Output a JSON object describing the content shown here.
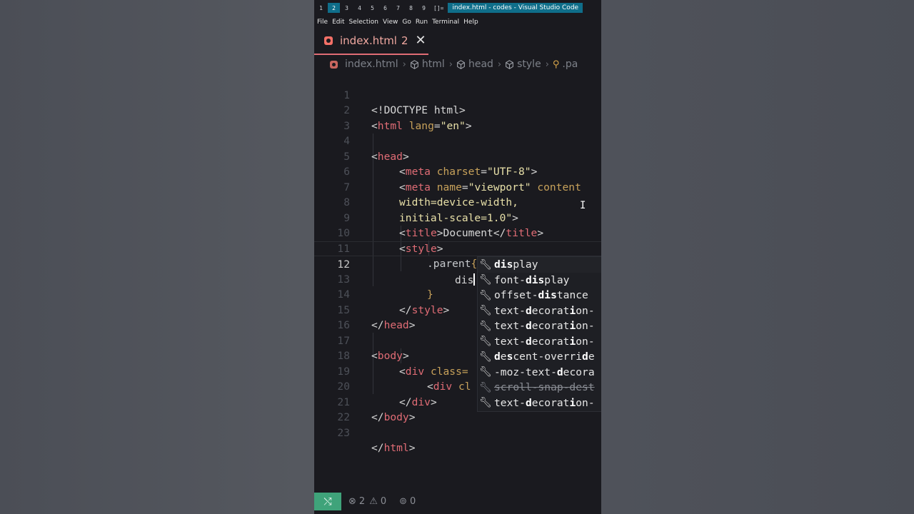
{
  "window": {
    "workspaces": [
      "1",
      "2",
      "3",
      "4",
      "5",
      "6",
      "7",
      "8",
      "9"
    ],
    "active_workspace": "2",
    "layout_indicator": "[]=",
    "title": "index.html - codes - Visual Studio Code"
  },
  "menu": [
    "File",
    "Edit",
    "Selection",
    "View",
    "Go",
    "Run",
    "Terminal",
    "Help"
  ],
  "tab": {
    "label": "index.html",
    "badge": "2",
    "close": "✕"
  },
  "breadcrumb": {
    "file": "index.html",
    "html": "html",
    "head": "head",
    "style": "style",
    "paren": ".pa"
  },
  "line_numbers": [
    "1",
    "2",
    "3",
    "4",
    "5",
    "6",
    "7",
    "8",
    "9",
    "10",
    "11",
    "12",
    "13",
    "14",
    "15",
    "16",
    "17",
    "18",
    "19",
    "20",
    "21",
    "22",
    "23"
  ],
  "code": {
    "l1": "<!DOCTYPE html>",
    "l2_lt": "<",
    "l2_tag": "html",
    "l2_attr": " lang",
    "l2_eq": "=",
    "l2_val": "\"en\"",
    "l2_gt": ">",
    "l4_lt": "<",
    "l4_tag": "head",
    "l4_gt": ">",
    "l5_lt": "<",
    "l5_tag": "meta",
    "l5_attr": " charset",
    "l5_eq": "=",
    "l5_val": "\"UTF-8\"",
    "l5_gt": ">",
    "l6_lt": "<",
    "l6_tag": "meta",
    "l6_attr": " name",
    "l6_eq": "=",
    "l6_val": "\"viewport\"",
    "l6_attr2": " content",
    "l7": "width=device-width,",
    "l8_text": "initial-scale=1.0\"",
    "l8_gt": ">",
    "l9_lt": "<",
    "l9_tag": "title",
    "l9_gt": ">",
    "l9_text": "Document",
    "l9_clt": "</",
    "l9_ctag": "title",
    "l9_cgt": ">",
    "l10_lt": "<",
    "l10_tag": "style",
    "l10_gt": ">",
    "l11_sel": ".parent",
    "l11_brace": "{",
    "l12": "dis",
    "l13": "}",
    "l14_lt": "</",
    "l14_tag": "style",
    "l14_gt": ">",
    "l15_lt": "</",
    "l15_tag": "head",
    "l15_gt": ">",
    "l17_lt": "<",
    "l17_tag": "body",
    "l17_gt": ">",
    "l18_lt": "<",
    "l18_tag": "div",
    "l18_attr": " class=",
    "l19_lt": "<",
    "l19_tag": "div",
    "l19_attr": " cl",
    "l20_lt": "</",
    "l20_tag": "div",
    "l20_gt": ">",
    "l21_lt": "</",
    "l21_tag": "body",
    "l21_gt": ">",
    "l23_lt": "</",
    "l23_tag": "html",
    "l23_gt": ">"
  },
  "suggestions": [
    {
      "match": "dis",
      "rest": "play"
    },
    {
      "pre": "font-",
      "match": "dis",
      "rest": "play"
    },
    {
      "pre": "offset-",
      "match": "dis",
      "rest": "tance"
    },
    {
      "pre": "text-",
      "match": "d",
      "mid": "ecorat",
      "match2": "i",
      "rest": "on-"
    },
    {
      "pre": "text-",
      "match": "d",
      "mid": "ecorat",
      "match2": "i",
      "rest": "on-"
    },
    {
      "pre": "text-",
      "match": "d",
      "mid": "ecorat",
      "match2": "i",
      "rest": "on-"
    },
    {
      "match": "d",
      "mid": "e",
      "match2": "s",
      "rest": "cent-overri",
      "match3": "d",
      "rest2": "e"
    },
    {
      "pre": "-moz-text-",
      "match": "d",
      "rest": "ecora"
    },
    {
      "text": "scroll-snap-dest"
    },
    {
      "pre": "text-",
      "match": "d",
      "mid": "ecorat",
      "match2": "i",
      "rest": "on-"
    }
  ],
  "suggest_icon": "wrench-icon",
  "status": {
    "errors": "2",
    "warnings": "0",
    "ports": "0"
  },
  "colors": {
    "tag": "#e06c75",
    "attr": "#c7a15a",
    "string": "#e8e0a8",
    "remote": "#3fa37a",
    "accent": "#0f6e8a"
  }
}
